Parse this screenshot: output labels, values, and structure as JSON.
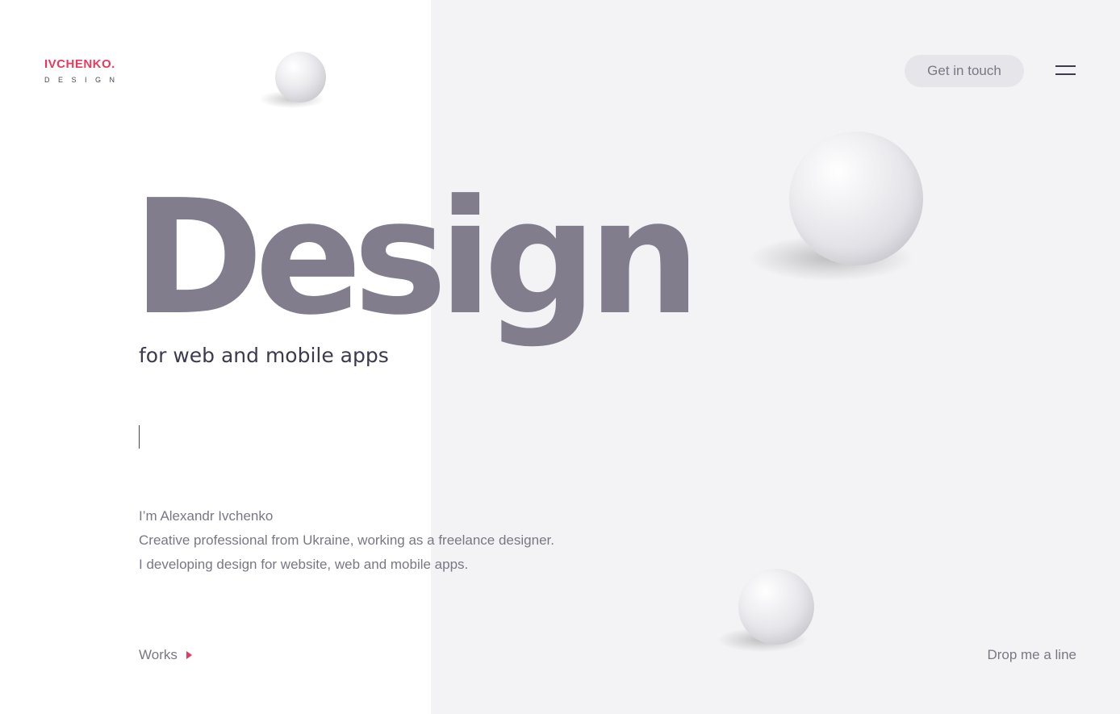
{
  "logo": {
    "name": "IVCHENKO.",
    "sub": "DESIGN"
  },
  "header": {
    "cta_label": "Get in touch",
    "menu_icon": "hamburger-menu-icon"
  },
  "hero": {
    "title": "Design",
    "subtitle": "for web and mobile apps"
  },
  "intro": {
    "lines": [
      "I’m Alexandr Ivchenko",
      "Creative professional from Ukraine, working as a freelance designer.",
      "I developing design for website, web and mobile apps."
    ]
  },
  "footer": {
    "works_label": "Works",
    "works_icon": "triangle-right-icon",
    "contact_label": "Drop me a line"
  },
  "colors": {
    "accent": "#e83a5c",
    "hero_title": "#817d8d",
    "text_dark": "#3e3a4e",
    "text_muted": "#7a7784",
    "panel_bg": "#f3f3f5",
    "button_bg": "#e6e6ea"
  }
}
